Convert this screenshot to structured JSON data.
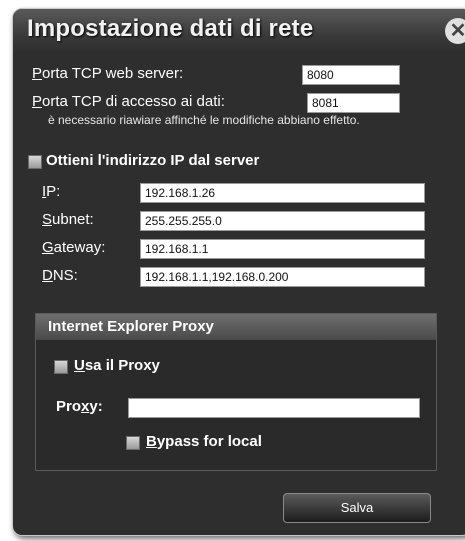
{
  "dialog": {
    "title": "Impostazione dati di rete",
    "close_glyph": "✕"
  },
  "server": {
    "web_port_label_key": "P",
    "web_port_label_rest": "orta TCP web server:",
    "web_port_value": "8080",
    "data_port_label_key": "P",
    "data_port_label_rest": "orta TCP di accesso ai dati:",
    "data_port_value": "8081",
    "restart_note": "è necessario riawiare affinché le modifiche abbiano effetto."
  },
  "ip_settings": {
    "obtain_from_server_label": "Ottieni l'indirizzo IP dal server",
    "ip_label_key": "I",
    "ip_label_rest": "P:",
    "ip_value": "192.168.1.26",
    "subnet_label_key": "S",
    "subnet_label_rest": "ubnet:",
    "subnet_value": "255.255.255.0",
    "gateway_label_key": "G",
    "gateway_label_rest": "ateway:",
    "gateway_value": "192.168.1.1",
    "dns_label_key": "D",
    "dns_label_rest": "NS:",
    "dns_value": "192.168.1.1,192.168.0.200"
  },
  "proxy": {
    "group_title": "Internet Explorer Proxy",
    "use_proxy_key": "U",
    "use_proxy_rest": "sa il Proxy",
    "proxy_label_pre": "Pro",
    "proxy_label_key": "x",
    "proxy_label_post": "y:",
    "proxy_value": "",
    "bypass_key": "B",
    "bypass_rest": "ypass for local"
  },
  "footer": {
    "save_label": "Salva"
  },
  "colors": {
    "dialog_bg": "#2e2e2e",
    "text": "#ffffff"
  }
}
